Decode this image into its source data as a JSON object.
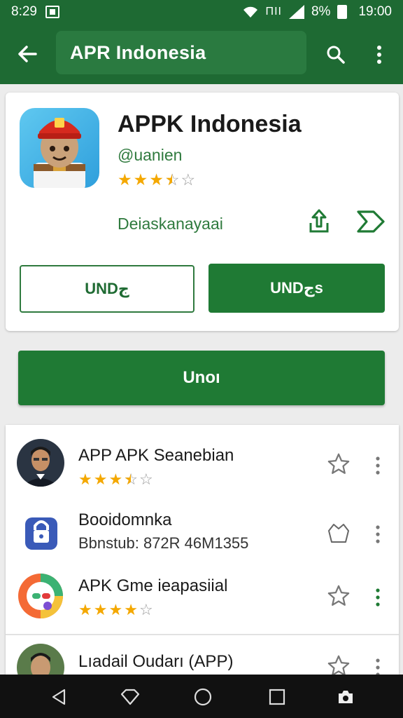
{
  "status_bar": {
    "time_left": "8:29",
    "battery_percent": "8%",
    "time_right": "19:00",
    "sim_text": "ΠΙΙ"
  },
  "app_bar": {
    "title": "APR Indonesia"
  },
  "app": {
    "name": "APPK Indonesia",
    "developer": "@uanien",
    "rating": 3.5,
    "description_link": "Deiaskanayaai",
    "outline_button": "UNDج",
    "filled_button": "UNDجs"
  },
  "main_button": "Unoı",
  "list": [
    {
      "title": "APP APK Seanebian",
      "rating": 3.5,
      "subtitle": ""
    },
    {
      "title": "Booidomnka",
      "rating": null,
      "subtitle": "Bbnstub: 872R 46M1355"
    },
    {
      "title": "APK Gme ieapasiial",
      "rating": 4,
      "subtitle": ""
    },
    {
      "title": "Lıadail Oudarı (APP)",
      "rating": null,
      "subtitle": ""
    }
  ],
  "colors": {
    "primary": "#1e6a33",
    "accent": "#1f7a34",
    "star": "#f4a800"
  }
}
